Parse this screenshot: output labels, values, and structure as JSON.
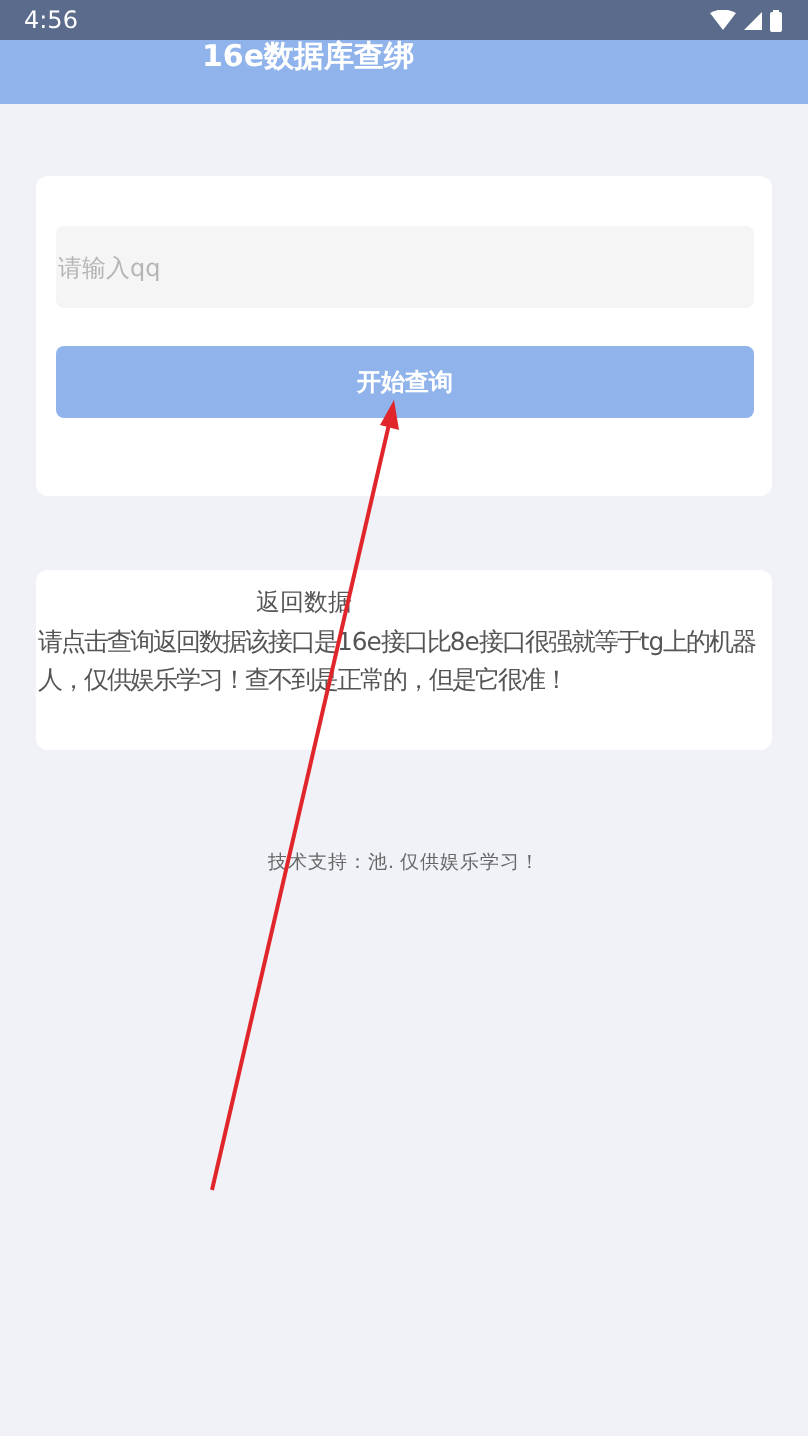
{
  "status_bar": {
    "time": "4:56"
  },
  "header": {
    "title": "16e数据库查绑"
  },
  "query_card": {
    "input": {
      "placeholder": "请输入qq"
    },
    "button": "开始查询"
  },
  "result_card": {
    "title": "返回数据",
    "text": "请点击查询返回数据该接口是16e接口比8e接口很强就等于tg上的机器人，仅供娱乐学习！查不到是正常的，但是它很准！"
  },
  "footer": "技术支持：池. 仅供娱乐学习！",
  "annotations": [
    {
      "kind": "arrow"
    }
  ]
}
